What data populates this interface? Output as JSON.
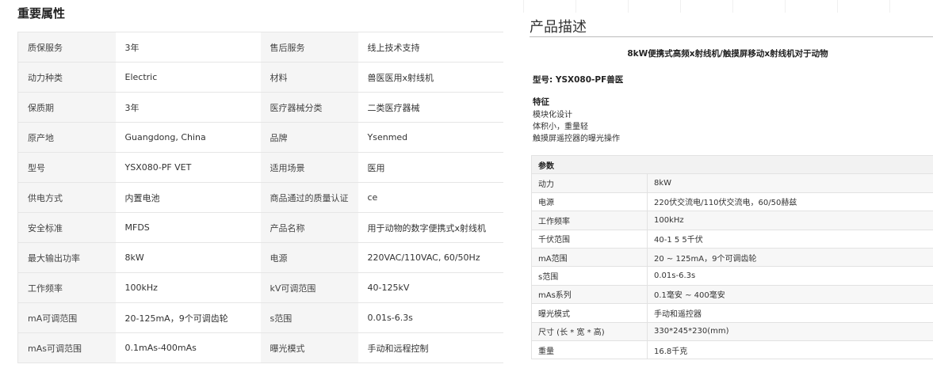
{
  "left": {
    "title": "重要属性",
    "rows": [
      [
        "质保服务",
        "3年",
        "售后服务",
        "线上技术支持"
      ],
      [
        "动力种类",
        "Electric",
        "材料",
        "兽医医用x射线机"
      ],
      [
        "保质期",
        "3年",
        "医疗器械分类",
        "二类医疗器械"
      ],
      [
        "原产地",
        "Guangdong, China",
        "品牌",
        "Ysenmed"
      ],
      [
        "型号",
        "YSX080-PF VET",
        "适用场景",
        "医用"
      ],
      [
        "供电方式",
        "内置电池",
        "商品通过的质量认证",
        "ce"
      ],
      [
        "安全标准",
        "MFDS",
        "产品名称",
        "用于动物的数字便携式x射线机"
      ],
      [
        "最大输出功率",
        "8kW",
        "电源",
        "220VAC/110VAC, 60/50Hz"
      ],
      [
        "工作频率",
        "100kHz",
        "kV可调范围",
        "40-125kV"
      ],
      [
        "mA可调范围",
        "20-125mA，9个可调齿轮",
        "s范围",
        "0.01s-6.3s"
      ],
      [
        "mAs可调范围",
        "0.1mAs-400mAs",
        "曝光模式",
        "手动和远程控制"
      ]
    ]
  },
  "right": {
    "title": "产品描述",
    "heading": "8kW便携式高频x射线机/触摸屏移动x射线机对于动物",
    "model": "型号: YSX080-PF兽医",
    "features_title": "特征",
    "features": [
      "模块化设计",
      "体积小，重量轻",
      "触摸屏遥控器的曝光操作"
    ],
    "params_header": "参数",
    "params": [
      [
        "动力",
        "8kW"
      ],
      [
        "电源",
        "220伏交流电/110伏交流电，60/50赫兹"
      ],
      [
        "工作频率",
        "100kHz"
      ],
      [
        "千伏范围",
        "40-1 5 5千伏"
      ],
      [
        "mA范围",
        "20 ~ 125mA，9个可调齿轮"
      ],
      [
        "s范围",
        "0.01s-6.3s"
      ],
      [
        "mAs系列",
        "0.1毫安 ~ 400毫安"
      ],
      [
        "曝光模式",
        "手动和遥控器"
      ],
      [
        "尺寸 (长 * 宽 * 高)",
        "330*245*230(mm)"
      ],
      [
        "重量",
        "16.8千克"
      ]
    ]
  }
}
